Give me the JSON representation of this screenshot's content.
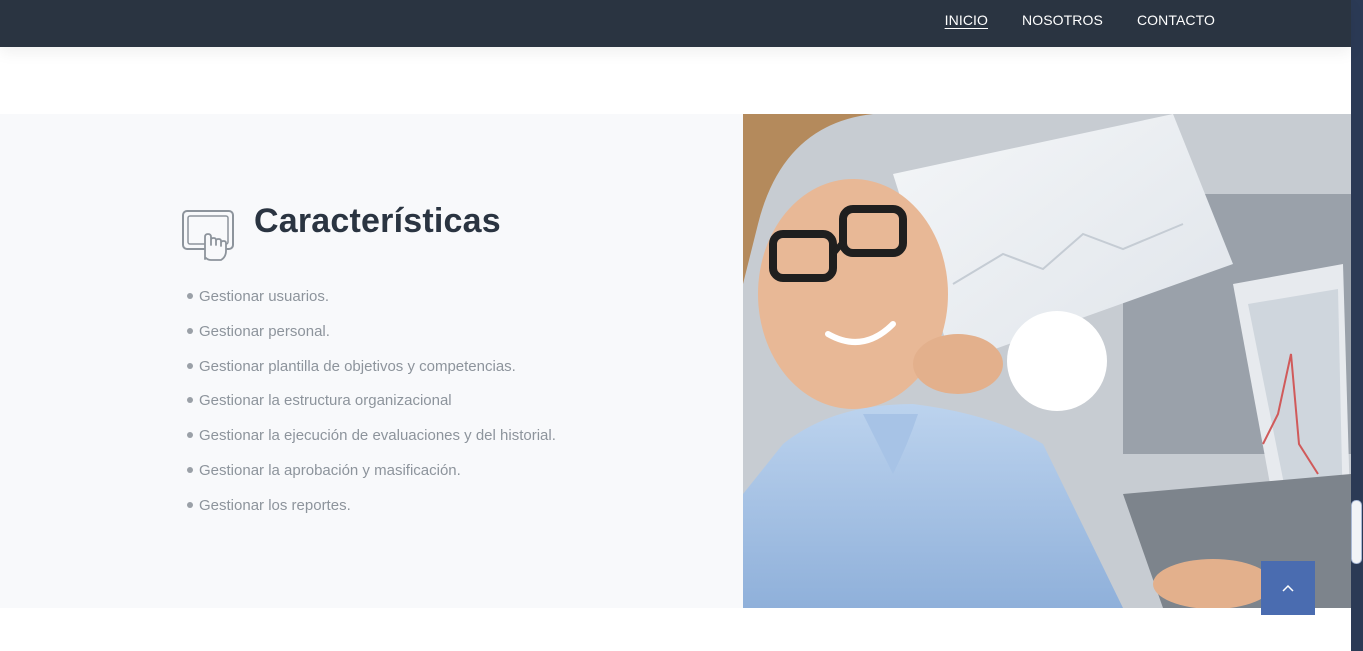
{
  "nav": {
    "links": [
      {
        "label": "INICIO",
        "active": true
      },
      {
        "label": "NOSOTROS",
        "active": false
      },
      {
        "label": "CONTACTO",
        "active": false
      }
    ]
  },
  "features": {
    "icon": "tablet-touch-icon",
    "title": "Características",
    "items": [
      "Gestionar usuarios.",
      "Gestionar personal.",
      "Gestionar plantilla de objetivos y competencias.",
      "Gestionar la estructura organizacional",
      "Gestionar la ejecución de evaluaciones y del historial.",
      "Gestionar la aprobación y masificación.",
      "Gestionar los reportes."
    ]
  },
  "image": {
    "icon": "business-man-photo"
  },
  "controls": {
    "back_to_top_icon": "chevron-up-icon"
  },
  "colors": {
    "navbar": "#2a3441",
    "section_bg": "#f8f9fb",
    "title": "#2a3441",
    "text_muted": "#8d949c",
    "accent_button": "#4a6cb0"
  }
}
